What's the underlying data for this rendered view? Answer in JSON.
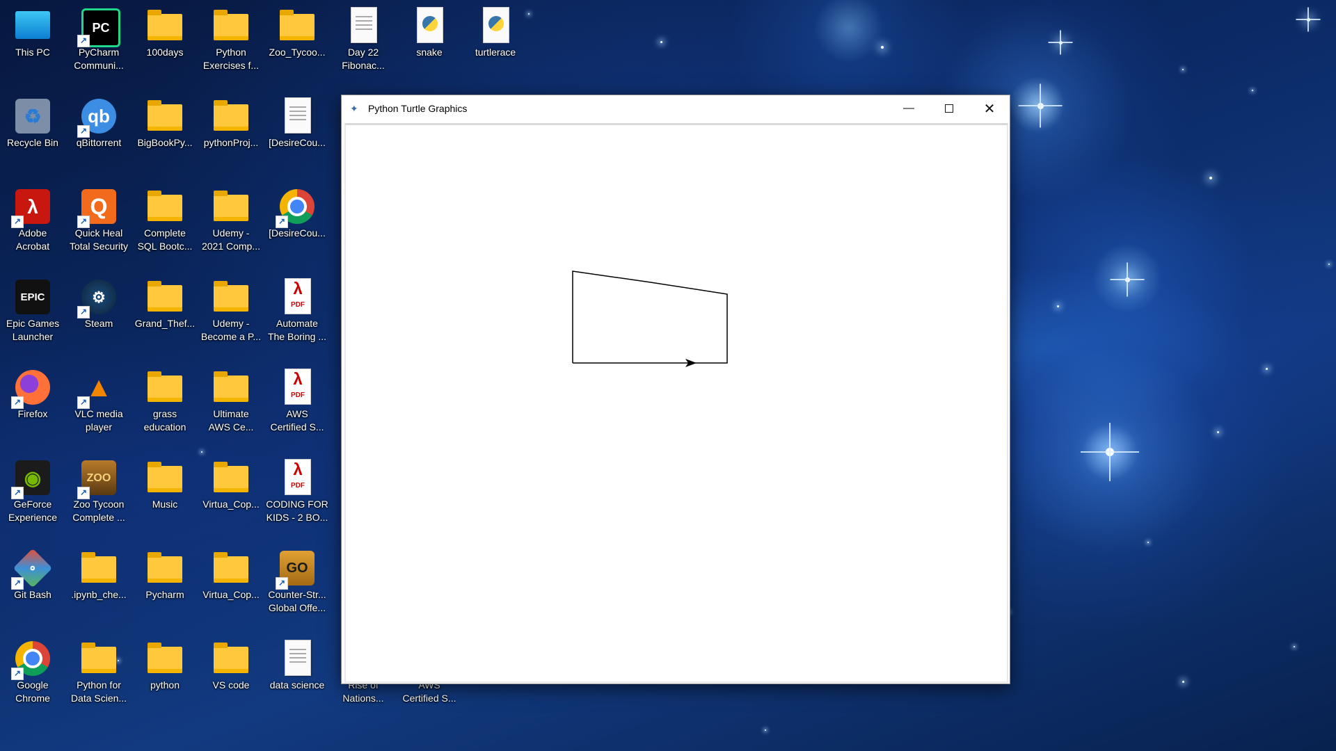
{
  "desktop": {
    "icons": [
      {
        "label": "This PC",
        "type": "pc"
      },
      {
        "label": "PyCharm\nCommuni...",
        "type": "pycharm",
        "shortcut": true
      },
      {
        "label": "100days",
        "type": "folder"
      },
      {
        "label": "Python\nExercises f...",
        "type": "folder"
      },
      {
        "label": "Zoo_Tycoo...",
        "type": "folder"
      },
      {
        "label": "Day 22\nFibonac...",
        "type": "file"
      },
      {
        "label": "snake",
        "type": "python"
      },
      {
        "label": "turtlerace",
        "type": "python"
      },
      {
        "label": "Recycle Bin",
        "type": "recycle"
      },
      {
        "label": "qBittorrent",
        "type": "qbit",
        "shortcut": true
      },
      {
        "label": "BigBookPy...",
        "type": "folder"
      },
      {
        "label": "pythonProj...",
        "type": "folder"
      },
      {
        "label": "[DesireCou...",
        "type": "file"
      },
      {
        "label": "Adobe\nAcrobat",
        "type": "acrobat",
        "shortcut": true
      },
      {
        "label": "Quick Heal\nTotal Security",
        "type": "quickheal",
        "shortcut": true
      },
      {
        "label": "Complete\nSQL Bootc...",
        "type": "folder"
      },
      {
        "label": "Udemy -\n2021 Comp...",
        "type": "folder"
      },
      {
        "label": "[DesireCou...",
        "type": "chrome",
        "shortcut": true
      },
      {
        "label": "Epic Games\nLauncher",
        "type": "epic"
      },
      {
        "label": "Steam",
        "type": "steam",
        "shortcut": true
      },
      {
        "label": "Grand_Thef...",
        "type": "folder"
      },
      {
        "label": "Udemy -\nBecome a P...",
        "type": "folder"
      },
      {
        "label": "Automate\nThe Boring ...",
        "type": "pdf"
      },
      {
        "label": "Firefox",
        "type": "firefox",
        "shortcut": true
      },
      {
        "label": "VLC media\nplayer",
        "type": "vlc",
        "shortcut": true
      },
      {
        "label": "grass\neducation",
        "type": "folder"
      },
      {
        "label": "Ultimate\nAWS Ce...",
        "type": "folder"
      },
      {
        "label": "AWS\nCertified S...",
        "type": "pdf"
      },
      {
        "label": "GeForce\nExperience",
        "type": "nvidia",
        "shortcut": true
      },
      {
        "label": "Zoo Tycoon\nComplete ...",
        "type": "zoo",
        "shortcut": true
      },
      {
        "label": "Music",
        "type": "folder"
      },
      {
        "label": "Virtua_Cop...",
        "type": "folder"
      },
      {
        "label": "CODING FOR\nKIDS - 2 BO...",
        "type": "pdf"
      },
      {
        "label": "Git Bash",
        "type": "git",
        "shortcut": true
      },
      {
        "label": ".ipynb_che...",
        "type": "folder"
      },
      {
        "label": "Pycharm",
        "type": "folder"
      },
      {
        "label": "Virtua_Cop...",
        "type": "folder"
      },
      {
        "label": "Counter-Str...\nGlobal Offe...",
        "type": "csgo",
        "shortcut": true
      },
      {
        "label": "Google\nChrome",
        "type": "chrome",
        "shortcut": true
      },
      {
        "label": "Python for\nData Scien...",
        "type": "folder"
      },
      {
        "label": "python",
        "type": "folder"
      },
      {
        "label": "VS code",
        "type": "folder"
      },
      {
        "label": "data science",
        "type": "file"
      },
      {
        "label": "Rise of\nNations...",
        "type": "hidden"
      },
      {
        "label": "AWS\nCertified S...",
        "type": "hidden"
      }
    ]
  },
  "window": {
    "title": "Python Turtle Graphics",
    "title_icon": "feather-icon",
    "buttons": {
      "minimize": "minimize-icon",
      "maximize": "maximize-icon",
      "close": "close-icon"
    }
  },
  "canvas": {
    "drawing": "open four-sided shape drawn by the turtle; turtle arrow cursor on bottom edge pointing right",
    "stroke_color": "#000000",
    "background_color": "#ffffff"
  }
}
